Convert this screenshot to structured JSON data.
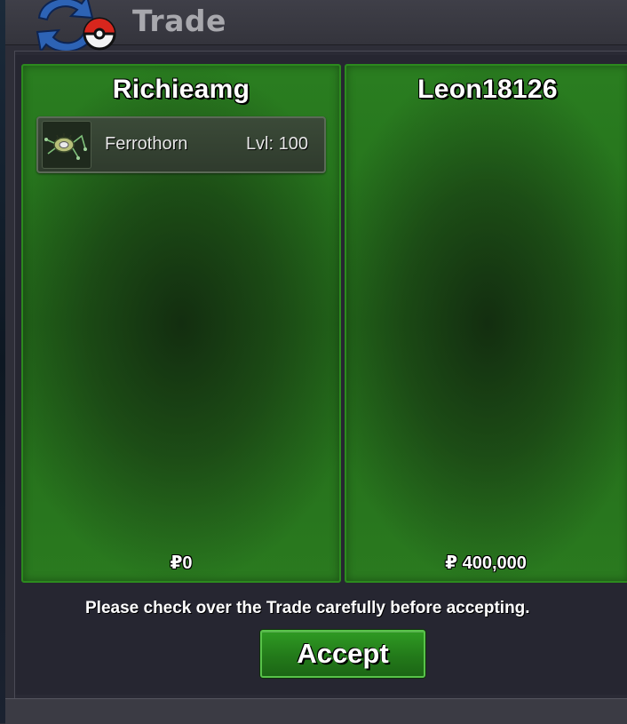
{
  "window": {
    "title": "Trade",
    "logo_icon": "pokeball-trade-arrows-icon"
  },
  "trade": {
    "left_player": {
      "name": "Richieamg",
      "items": [
        {
          "name": "Ferrothorn",
          "level": "Lvl: 100",
          "icon": "ferrothorn-sprite-icon"
        }
      ],
      "money": "₽0"
    },
    "right_player": {
      "name": "Leon18126",
      "items": [],
      "money": "₽ 400,000"
    }
  },
  "notice": "Please check over the Trade carefully before accepting.",
  "accept_label": "Accept",
  "colors": {
    "panel_green": "#2a7e20",
    "panel_border": "#2c8a1e",
    "button_green": "#237a1a",
    "background": "#262631"
  }
}
